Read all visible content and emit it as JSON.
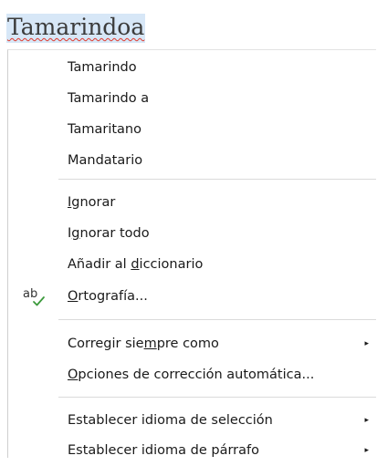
{
  "document": {
    "misspelled_word": "Tamarindoa"
  },
  "menu": {
    "suggestions": [
      "Tamarindo",
      "Tamarindo a",
      "Tamaritano",
      "Mandatario"
    ],
    "ignore": {
      "before": "",
      "key": "I",
      "after": "gnorar"
    },
    "ignore_all": {
      "before": "I",
      "key": "g",
      "after": "norar todo"
    },
    "add_to_dictionary": {
      "before": "Añadir al ",
      "key": "d",
      "after": "iccionario"
    },
    "spelling": {
      "before": "",
      "key": "O",
      "after": "rtografía..."
    },
    "spelling_icon": "spellcheck-icon",
    "always_correct": {
      "before": "Corregir sie",
      "key": "m",
      "after": "pre como"
    },
    "autocorrect_options": {
      "before": "",
      "key": "O",
      "after": "pciones de corrección automática..."
    },
    "selection_language": {
      "label": "Establecer idioma de selección"
    },
    "paragraph_language": {
      "label": "Establecer idioma de párrafo"
    },
    "submenu_arrow": "▸",
    "colors": {
      "word_highlight": "#d7e7f7",
      "spell_underline": "#e0392b",
      "icon_check": "#3c9a3c"
    }
  }
}
